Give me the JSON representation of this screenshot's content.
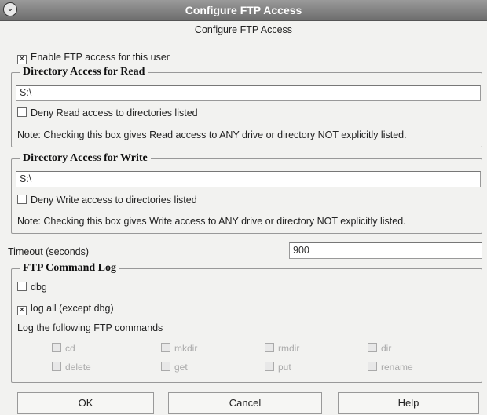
{
  "window": {
    "title": "Configure FTP Access",
    "subtitle": "Configure FTP Access",
    "system_button_icon": "chevron-down-icon"
  },
  "enable_ftp": {
    "label": "Enable FTP access for this user",
    "checked": true
  },
  "read_group": {
    "title": "Directory Access for Read",
    "path_value": "S:\\",
    "deny_label": "Deny Read access to directories listed",
    "deny_checked": false,
    "note": "Note: Checking this box gives Read access to ANY drive or directory NOT explicitly listed."
  },
  "write_group": {
    "title": "Directory Access for Write",
    "path_value": "S:\\",
    "deny_label": "Deny Write access to directories listed",
    "deny_checked": false,
    "note": "Note: Checking this box gives Write access to ANY drive or directory NOT explicitly listed."
  },
  "timeout": {
    "label": "Timeout (seconds)",
    "value": "900"
  },
  "log_group": {
    "title": "FTP Command Log",
    "dbg_label": "dbg",
    "dbg_checked": false,
    "logall_label": "log all (except dbg)",
    "logall_checked": true,
    "commands_label": "Log the following FTP commands",
    "commands": [
      "cd",
      "mkdir",
      "rmdir",
      "dir",
      "delete",
      "get",
      "put",
      "rename"
    ]
  },
  "buttons": {
    "ok": "OK",
    "cancel": "Cancel",
    "help": "Help"
  }
}
